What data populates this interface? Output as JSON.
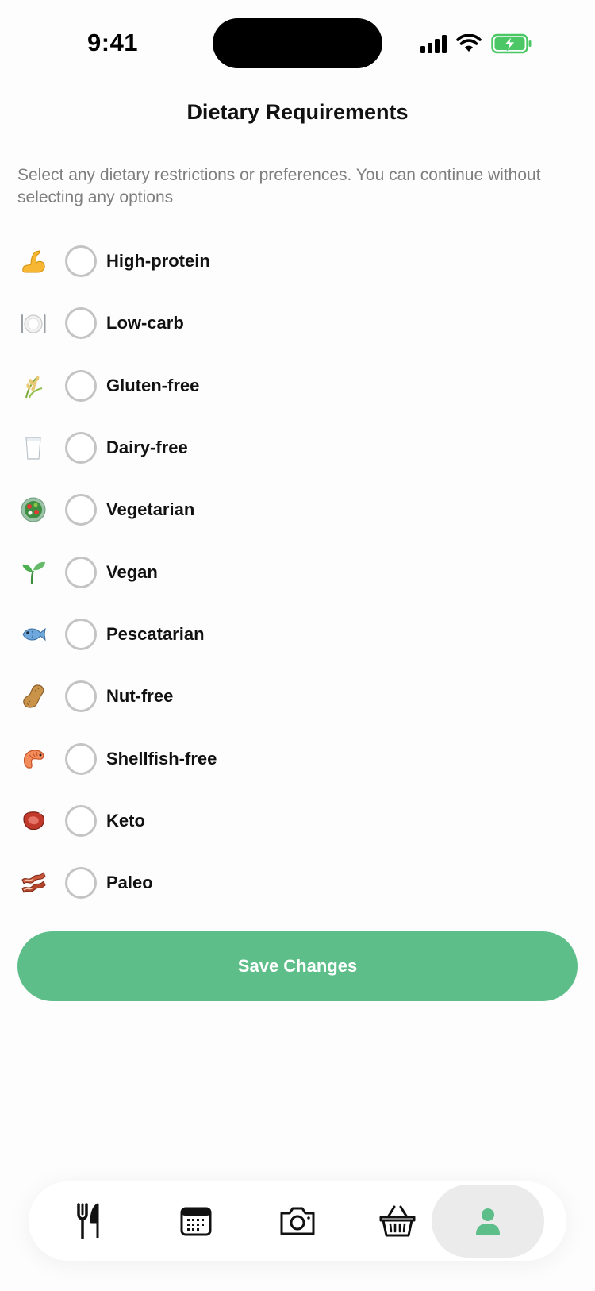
{
  "status_bar": {
    "time": "9:41"
  },
  "header": {
    "title": "Dietary Requirements",
    "subtitle": "Select any dietary restrictions or preferences. You can continue without selecting any options"
  },
  "options": [
    {
      "label": "High-protein",
      "icon": "flexed-biceps-icon",
      "selected": false
    },
    {
      "label": "Low-carb",
      "icon": "plate-cutlery-icon",
      "selected": false
    },
    {
      "label": "Gluten-free",
      "icon": "rice-ear-icon",
      "selected": false
    },
    {
      "label": "Dairy-free",
      "icon": "milk-glass-icon",
      "selected": false
    },
    {
      "label": "Vegetarian",
      "icon": "salad-icon",
      "selected": false
    },
    {
      "label": "Vegan",
      "icon": "seedling-icon",
      "selected": false
    },
    {
      "label": "Pescatarian",
      "icon": "fish-icon",
      "selected": false
    },
    {
      "label": "Nut-free",
      "icon": "peanut-icon",
      "selected": false
    },
    {
      "label": "Shellfish-free",
      "icon": "shrimp-icon",
      "selected": false
    },
    {
      "label": "Keto",
      "icon": "steak-icon",
      "selected": false
    },
    {
      "label": "Paleo",
      "icon": "bacon-icon",
      "selected": false
    }
  ],
  "save_button": {
    "label": "Save Changes"
  },
  "tab_bar": {
    "tabs": [
      {
        "icon": "fork-knife-icon",
        "active": false
      },
      {
        "icon": "calendar-icon",
        "active": false
      },
      {
        "icon": "camera-icon",
        "active": false
      },
      {
        "icon": "basket-icon",
        "active": false
      },
      {
        "icon": "profile-icon",
        "active": true
      }
    ]
  },
  "colors": {
    "accent": "#5DBE8A",
    "battery": "#4CC765",
    "radio_border": "#c4c4c4",
    "subtitle": "#7e7e7e"
  }
}
